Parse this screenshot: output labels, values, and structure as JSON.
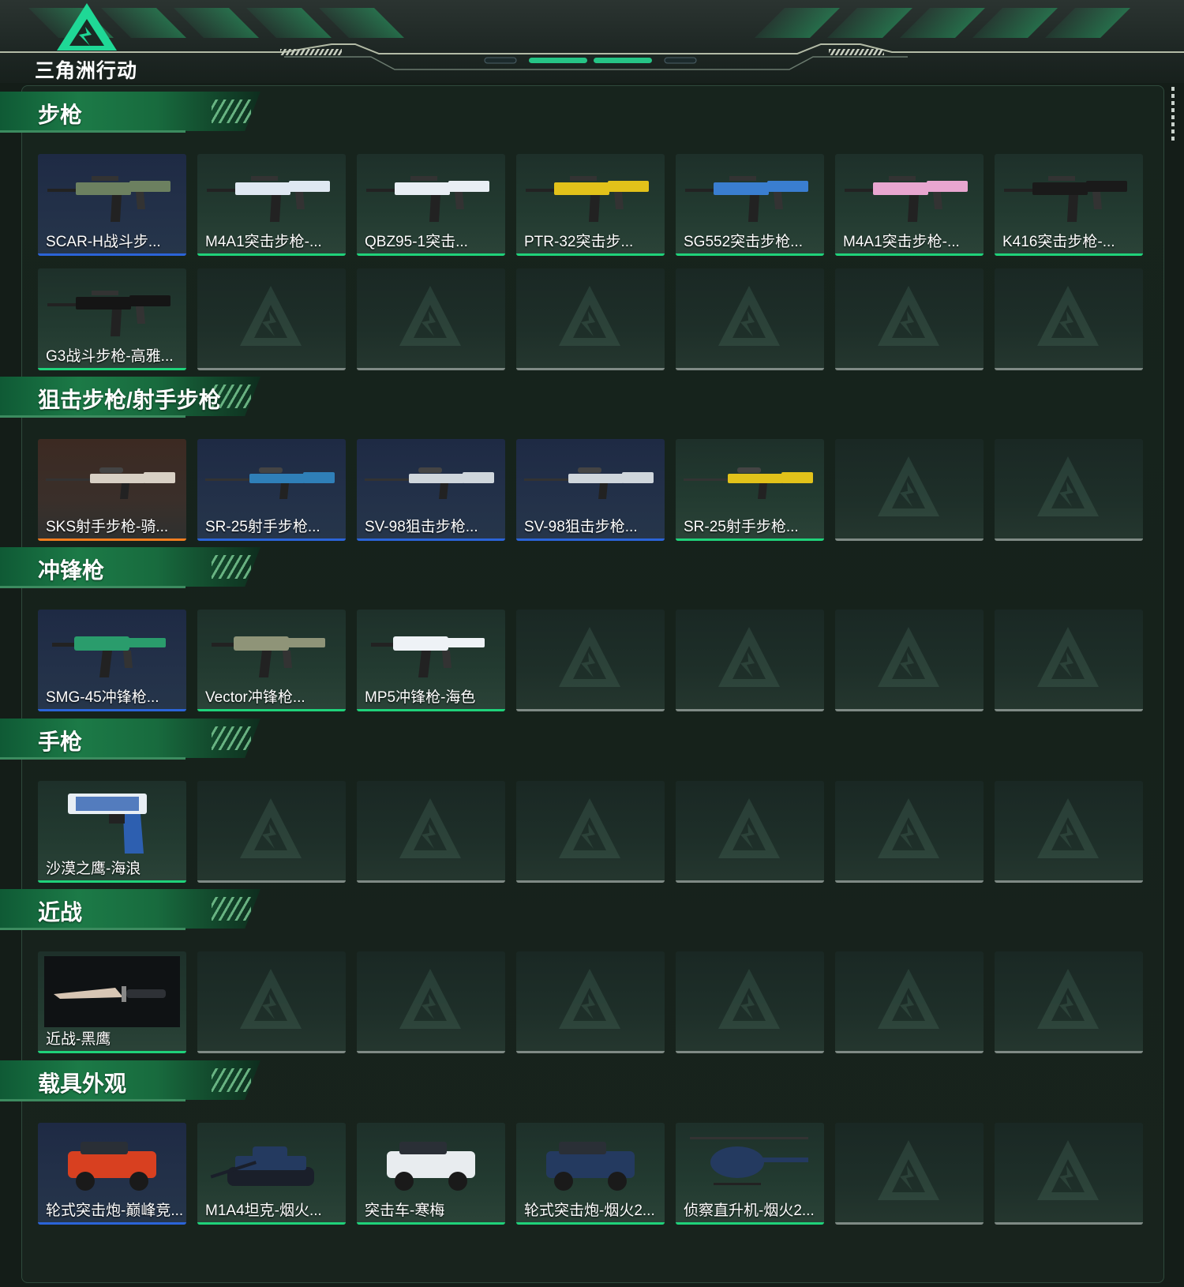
{
  "header": {
    "title": "三角洲行动"
  },
  "sections": [
    {
      "title": "步枪",
      "items": [
        {
          "name": "SCAR-H战斗步...",
          "rarity": "blue",
          "icon": "rifle-icon",
          "color": "#6c8060"
        },
        {
          "name": "M4A1突击步枪-...",
          "rarity": "green",
          "icon": "rifle-icon",
          "color": "#dfe8f2"
        },
        {
          "name": "QBZ95-1突击...",
          "rarity": "green",
          "icon": "bullpup-rifle-icon",
          "color": "#e8eef4"
        },
        {
          "name": "PTR-32突击步...",
          "rarity": "green",
          "icon": "rifle-icon",
          "color": "#e2c21a"
        },
        {
          "name": "SG552突击步枪...",
          "rarity": "green",
          "icon": "rifle-icon",
          "color": "#3a7ed0"
        },
        {
          "name": "M4A1突击步枪-...",
          "rarity": "green",
          "icon": "rifle-icon",
          "color": "#e8a6d0"
        },
        {
          "name": "K416突击步枪-...",
          "rarity": "green",
          "icon": "rifle-icon",
          "color": "#1a1a1a"
        },
        {
          "name": "G3战斗步枪-高雅...",
          "rarity": "green",
          "icon": "rifle-icon",
          "color": "#151515"
        },
        null,
        null,
        null,
        null,
        null,
        null
      ]
    },
    {
      "title": "狙击步枪/射手步枪",
      "items": [
        {
          "name": "SKS射手步枪-骑...",
          "rarity": "orange",
          "icon": "sniper-rifle-icon",
          "color": "#d8d0c4"
        },
        {
          "name": "SR-25射手步枪...",
          "rarity": "blue",
          "icon": "sniper-rifle-icon",
          "color": "#2f7fb8"
        },
        {
          "name": "SV-98狙击步枪...",
          "rarity": "blue",
          "icon": "sniper-rifle-icon",
          "color": "#cfd6dc"
        },
        {
          "name": "SV-98狙击步枪...",
          "rarity": "blue",
          "icon": "sniper-rifle-icon",
          "color": "#cfd6dc"
        },
        {
          "name": "SR-25射手步枪...",
          "rarity": "green",
          "icon": "sniper-rifle-icon",
          "color": "#e2c21a"
        },
        null,
        null
      ]
    },
    {
      "title": "冲锋枪",
      "items": [
        {
          "name": "SMG-45冲锋枪...",
          "rarity": "blue",
          "icon": "smg-icon",
          "color": "#2a9c6c"
        },
        {
          "name": "Vector冲锋枪...",
          "rarity": "green",
          "icon": "smg-icon",
          "color": "#8f9478"
        },
        {
          "name": "MP5冲锋枪-海色",
          "rarity": "green",
          "icon": "smg-icon",
          "color": "#eef2f6"
        },
        null,
        null,
        null,
        null
      ]
    },
    {
      "title": "手枪",
      "items": [
        {
          "name": "沙漠之鹰-海浪",
          "rarity": "green",
          "icon": "pistol-icon",
          "color": "#2d5fb0"
        },
        null,
        null,
        null,
        null,
        null,
        null
      ]
    },
    {
      "title": "近战",
      "items": [
        {
          "name": "近战-黑鹰",
          "rarity": "green",
          "icon": "knife-icon",
          "color": "#d8c6b4"
        },
        null,
        null,
        null,
        null,
        null,
        null
      ]
    },
    {
      "title": "载具外观",
      "items": [
        {
          "name": "轮式突击炮-巅峰竞...",
          "rarity": "blue",
          "icon": "assault-vehicle-icon",
          "color": "#d84020"
        },
        {
          "name": "M1A4坦克-烟火...",
          "rarity": "green",
          "icon": "tank-icon",
          "color": "#243a60"
        },
        {
          "name": "突击车-寒梅",
          "rarity": "green",
          "icon": "armored-car-icon",
          "color": "#e8ecef"
        },
        {
          "name": "轮式突击炮-烟火2...",
          "rarity": "green",
          "icon": "assault-vehicle-icon",
          "color": "#243a60"
        },
        {
          "name": "侦察直升机-烟火2...",
          "rarity": "green",
          "icon": "helicopter-icon",
          "color": "#243a60"
        },
        null,
        null
      ]
    }
  ]
}
